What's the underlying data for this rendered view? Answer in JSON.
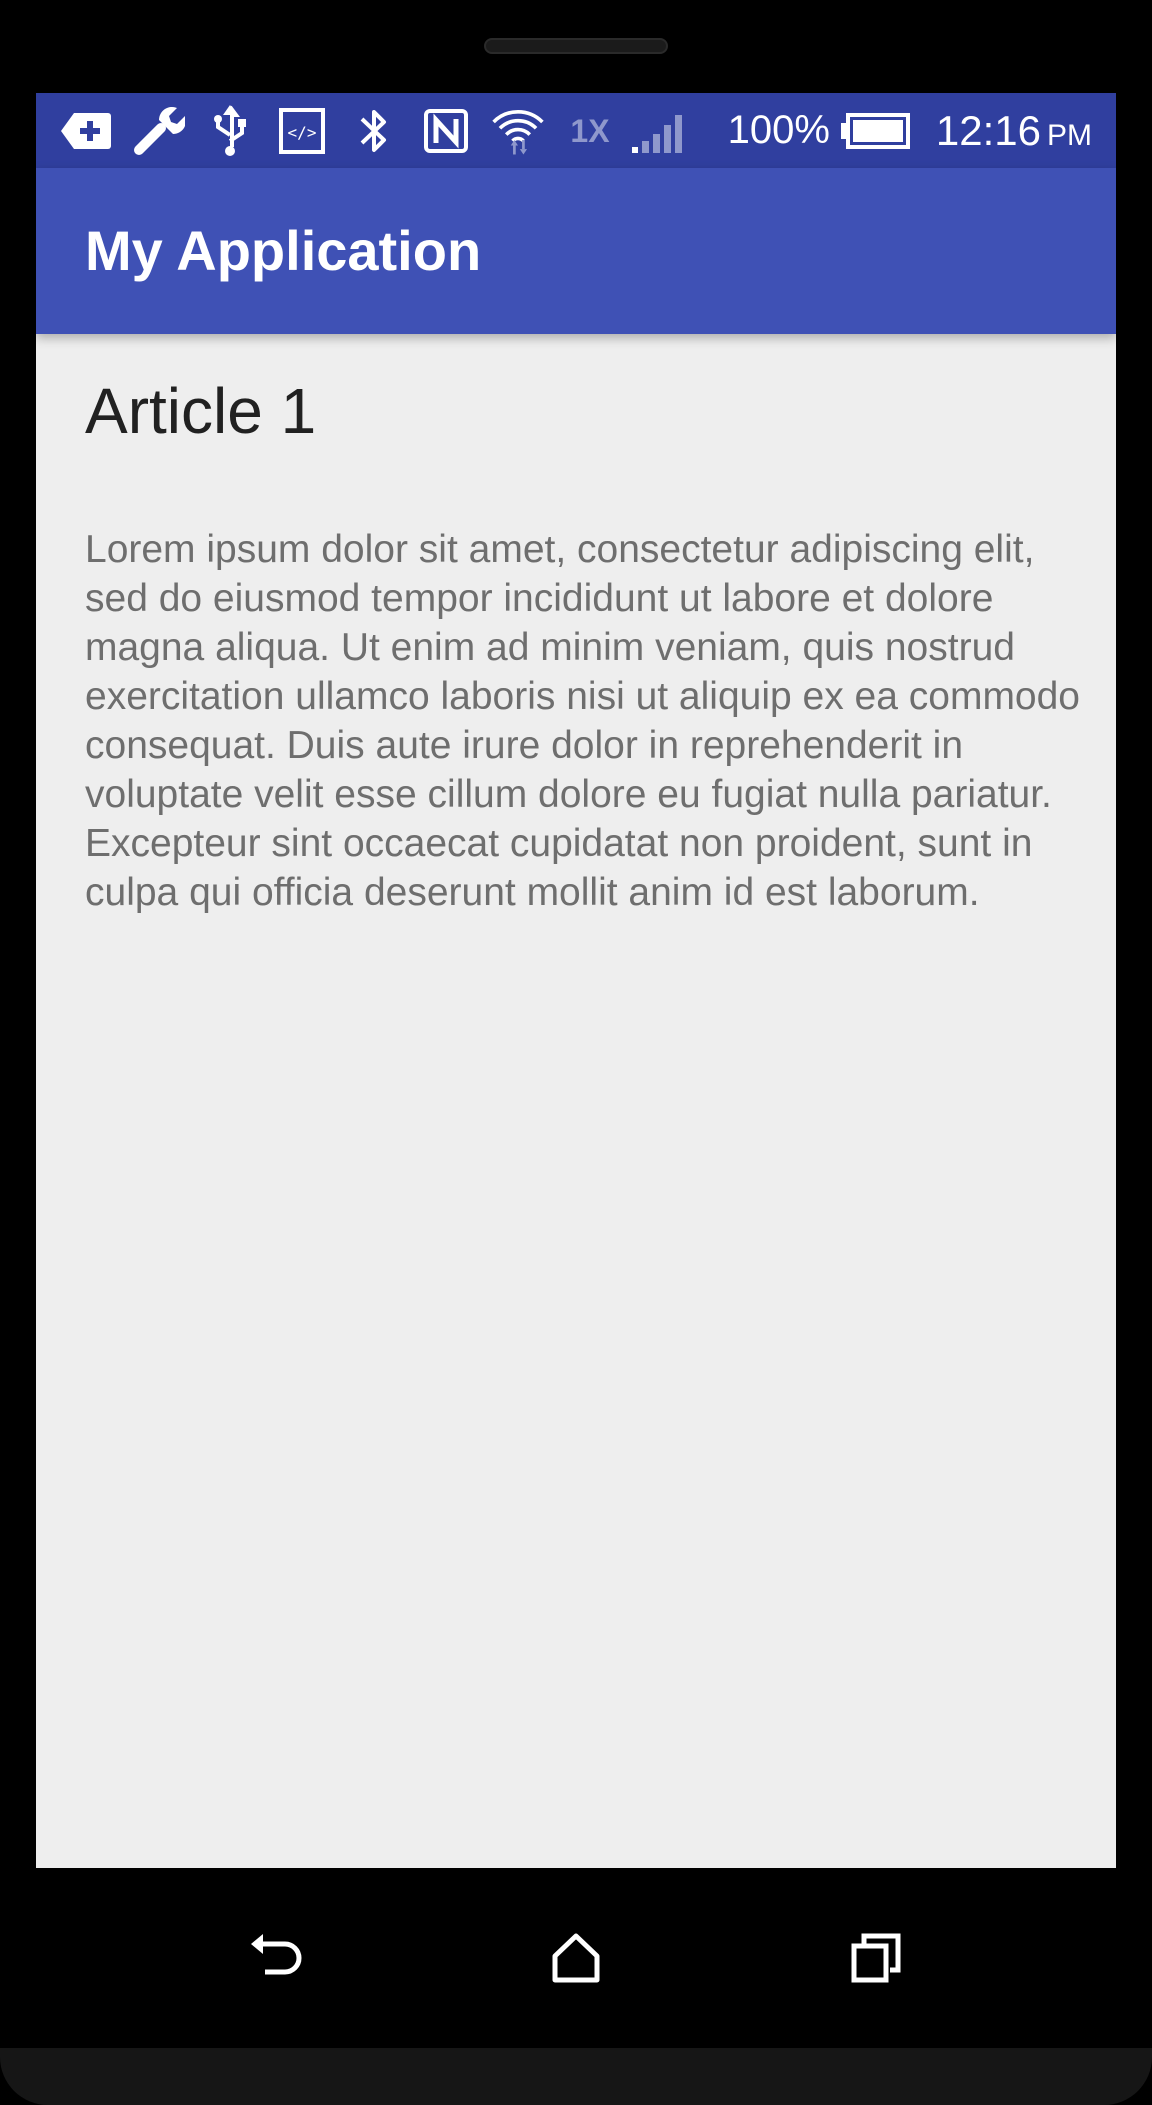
{
  "colors": {
    "status_bar": "#303f9f",
    "app_bar": "#3f51b5",
    "screen_bg": "#eeeeee",
    "title_text": "#212121",
    "body_text": "#6e6e6e"
  },
  "status_bar": {
    "icons": [
      "add-tag-icon",
      "wrench-icon",
      "usb-icon",
      "developer-code-icon",
      "bluetooth-icon",
      "nfc-icon",
      "wifi-icon"
    ],
    "network_type": "1X",
    "signal_icon": "cell-signal-icon",
    "battery_percent": "100%",
    "battery_icon": "battery-icon",
    "time": "12:16",
    "ampm": "PM"
  },
  "app_bar": {
    "title": "My Application"
  },
  "article": {
    "title": "Article 1",
    "body": "Lorem ipsum dolor sit amet, consectetur adipiscing elit, sed do eiusmod tempor incididunt ut labore et dolore magna aliqua. Ut enim ad minim veniam, quis nostrud exercitation ullamco laboris nisi ut aliquip ex ea commodo consequat. Duis aute irure dolor in reprehenderit in voluptate velit esse cillum dolore eu fugiat nulla pariatur. Excepteur sint occaecat cupidatat non proident, sunt in culpa qui officia deserunt mollit anim id est laborum."
  },
  "nav_bar": {
    "buttons": [
      "back-icon",
      "home-icon",
      "recents-icon"
    ]
  }
}
